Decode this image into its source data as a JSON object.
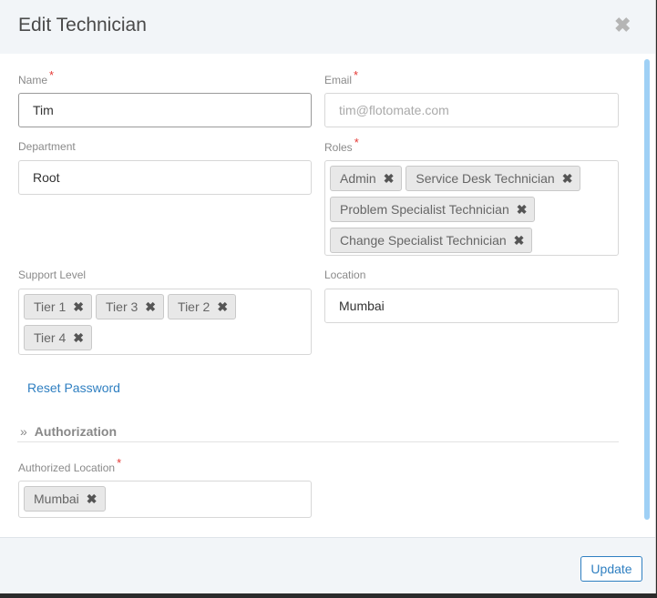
{
  "dialog": {
    "title": "Edit Technician",
    "close_icon": "close-icon",
    "update_label": "Update"
  },
  "form": {
    "name": {
      "label": "Name",
      "required": "*",
      "value": "Tim"
    },
    "email": {
      "label": "Email",
      "required": "*",
      "placeholder": "tim@flotomate.com"
    },
    "department": {
      "label": "Department",
      "value": "Root"
    },
    "roles": {
      "label": "Roles",
      "required": "*",
      "tags": [
        "Admin",
        "Service Desk Technician",
        "Problem Specialist Technician",
        "Change Specialist Technician"
      ]
    },
    "support_level": {
      "label": "Support Level",
      "tags": [
        "Tier 1",
        "Tier 3",
        "Tier 2",
        "Tier 4"
      ]
    },
    "location": {
      "label": "Location",
      "value": "Mumbai"
    },
    "reset_password": "Reset Password",
    "authorization": {
      "heading": "Authorization",
      "authorized_location": {
        "label": "Authorized Location",
        "required": "*",
        "tags": [
          "Mumbai"
        ]
      }
    }
  },
  "icons": {
    "tag_remove": "✖",
    "section_toggle": "»",
    "close": "✖"
  },
  "colors": {
    "accent": "#2f7fc1",
    "required": "#e53935",
    "header_bg": "#f2f5f8",
    "scrollbar": "#9fd0f5"
  }
}
